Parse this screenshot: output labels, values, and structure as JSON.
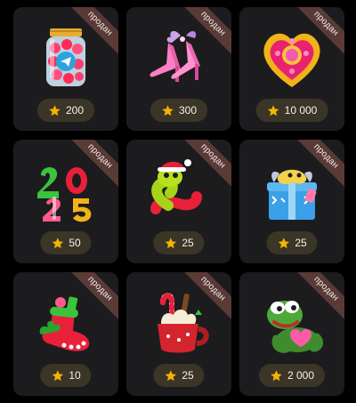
{
  "colors": {
    "card_bg": "#1c1c1f",
    "ribbon_bg": "#5a3a36",
    "price_pill_bg": "#3a3526",
    "star": "#f4b400"
  },
  "gifts": [
    {
      "icon": "candy-jar-icon",
      "status": "продан",
      "price": "200"
    },
    {
      "icon": "pink-heels-icon",
      "status": "продан",
      "price": "300"
    },
    {
      "icon": "heart-locket-icon",
      "status": "продан",
      "price": "10 000"
    },
    {
      "icon": "year-2025-icon",
      "status": "продан",
      "price": "50"
    },
    {
      "icon": "snake-santa-hat-icon",
      "status": "продан",
      "price": "25"
    },
    {
      "icon": "snake-gift-box-icon",
      "status": "продан",
      "price": "25"
    },
    {
      "icon": "christmas-stocking-icon",
      "status": "продан",
      "price": "10"
    },
    {
      "icon": "cocoa-mug-icon",
      "status": "продан",
      "price": "25"
    },
    {
      "icon": "pepe-frog-icon",
      "status": "продан",
      "price": "2 000"
    }
  ]
}
